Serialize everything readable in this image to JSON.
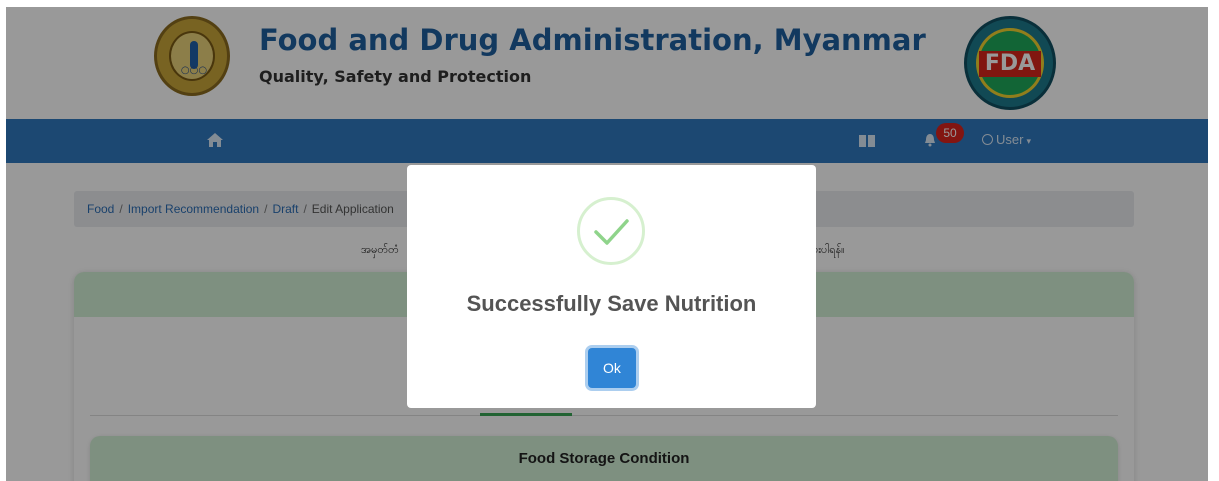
{
  "header": {
    "title": "Food and Drug Administration, Myanmar",
    "subtitle": "Quality, Safety and Protection",
    "right_logo_text": "FDA"
  },
  "navbar": {
    "notification_count": "50",
    "user_label": "User",
    "color": "#2f78be"
  },
  "breadcrumb": {
    "items": [
      "Food",
      "Import Recommendation",
      "Draft",
      "Edit Application"
    ],
    "separator": "/"
  },
  "notice": {
    "left_fragment": "အမှတ်တံ",
    "right_fragment": "ပေးပါရန်။"
  },
  "card": {
    "section_title": "Food Storage Condition"
  },
  "modal": {
    "message": "Successfully Save Nutrition",
    "ok_label": "Ok",
    "accent": "#3085d6",
    "icon": "success-check-icon"
  }
}
